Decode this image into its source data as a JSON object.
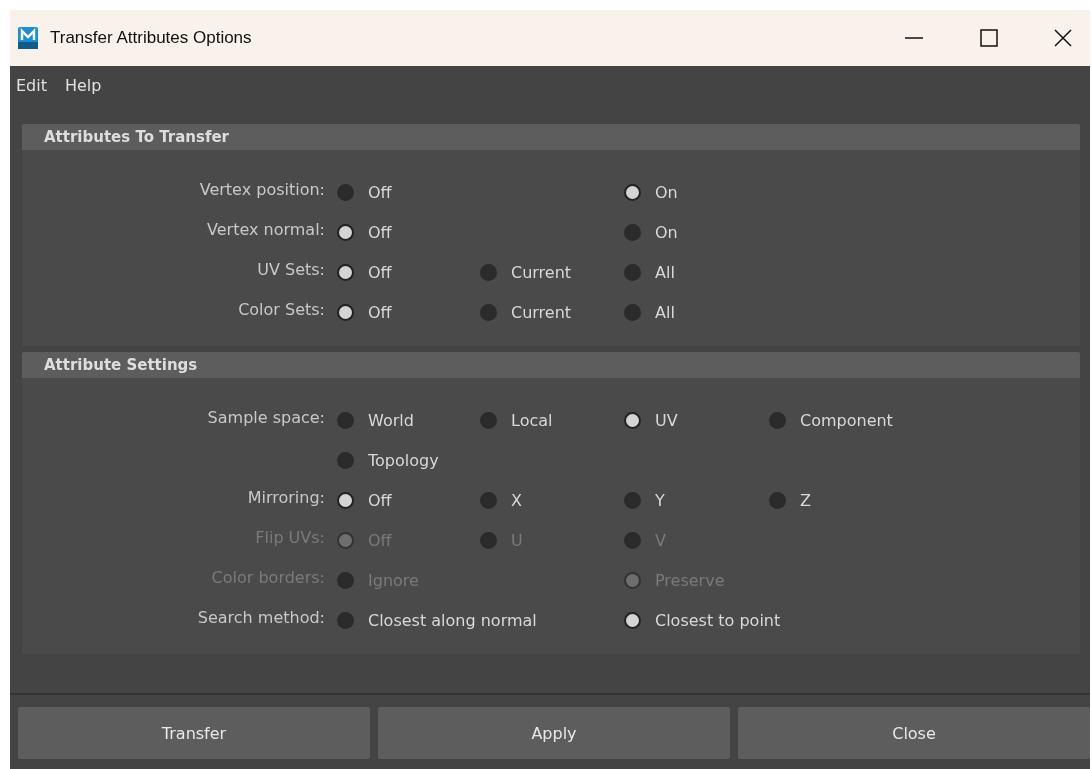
{
  "window": {
    "title": "Transfer Attributes Options"
  },
  "menu": [
    "Edit",
    "Help"
  ],
  "sections": [
    {
      "title": "Attributes To Transfer",
      "rows": [
        {
          "label": "Vertex position:",
          "disabled": false,
          "options": [
            {
              "label": "Off",
              "selected": false
            },
            {
              "label": "On",
              "selected": true
            }
          ]
        },
        {
          "label": "Vertex normal:",
          "disabled": false,
          "options": [
            {
              "label": "Off",
              "selected": true
            },
            {
              "label": "On",
              "selected": false
            }
          ]
        },
        {
          "label": "UV Sets:",
          "disabled": false,
          "options": [
            {
              "label": "Off",
              "selected": true
            },
            {
              "label": "Current",
              "selected": false
            },
            {
              "label": "All",
              "selected": false
            }
          ]
        },
        {
          "label": "Color Sets:",
          "disabled": false,
          "options": [
            {
              "label": "Off",
              "selected": true
            },
            {
              "label": "Current",
              "selected": false
            },
            {
              "label": "All",
              "selected": false
            }
          ]
        }
      ]
    },
    {
      "title": "Attribute Settings",
      "rows": [
        {
          "label": "Sample space:",
          "disabled": false,
          "options": [
            {
              "label": "World",
              "selected": false
            },
            {
              "label": "Local",
              "selected": false
            },
            {
              "label": "UV",
              "selected": true
            },
            {
              "label": "Component",
              "selected": false
            },
            {
              "label": "Topology",
              "selected": false
            }
          ]
        },
        {
          "label": "Mirroring:",
          "disabled": false,
          "options": [
            {
              "label": "Off",
              "selected": true
            },
            {
              "label": "X",
              "selected": false
            },
            {
              "label": "Y",
              "selected": false
            },
            {
              "label": "Z",
              "selected": false
            }
          ]
        },
        {
          "label": "Flip UVs:",
          "disabled": true,
          "options": [
            {
              "label": "Off",
              "selected": true
            },
            {
              "label": "U",
              "selected": false
            },
            {
              "label": "V",
              "selected": false
            }
          ]
        },
        {
          "label": "Color borders:",
          "disabled": true,
          "options": [
            {
              "label": "Ignore",
              "selected": false
            },
            {
              "label": "Preserve",
              "selected": true
            }
          ]
        },
        {
          "label": "Search method:",
          "disabled": false,
          "options": [
            {
              "label": "Closest along normal",
              "selected": false
            },
            {
              "label": "Closest to point",
              "selected": true
            }
          ]
        }
      ]
    }
  ],
  "buttons": [
    "Transfer",
    "Apply",
    "Close"
  ]
}
